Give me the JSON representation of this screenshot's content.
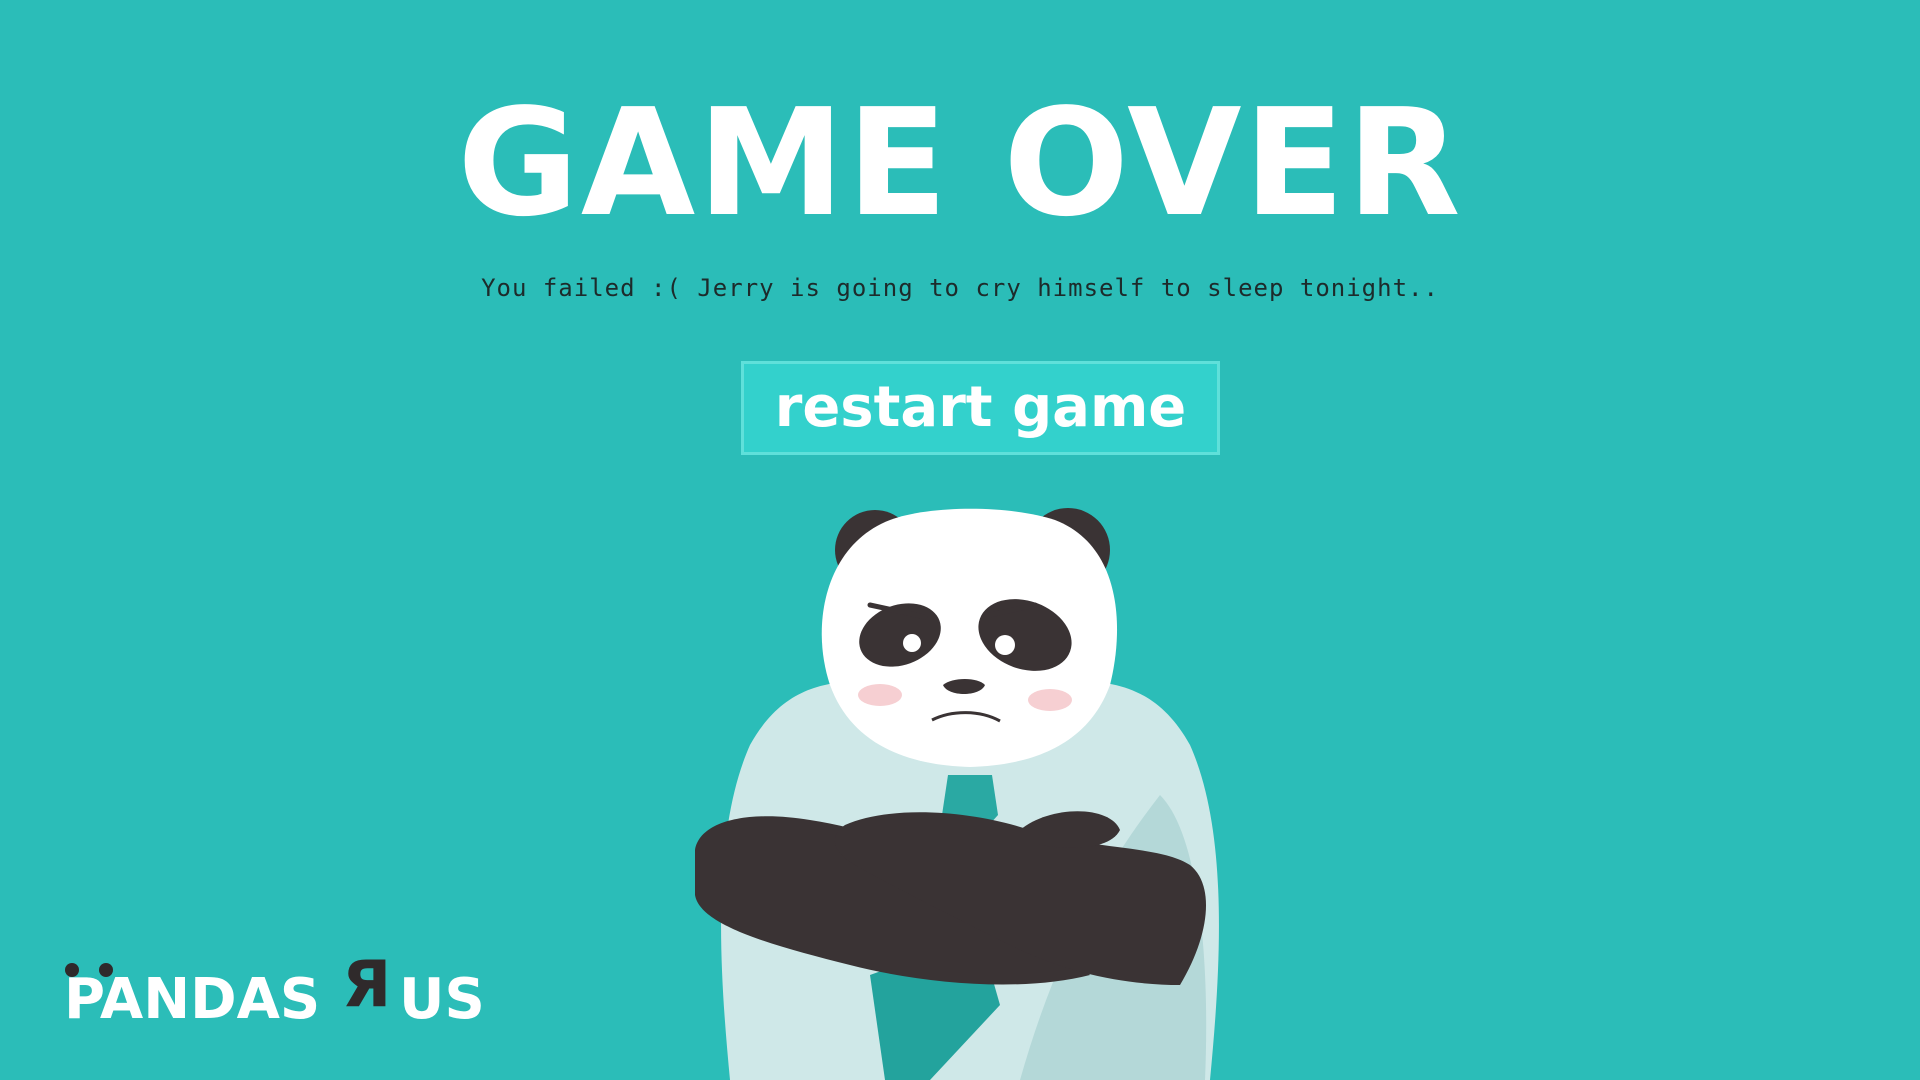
{
  "screen": {
    "title": "GAME OVER",
    "message": "You failed :( Jerry is going to cry himself to sleep tonight..",
    "restart_label": "restart game"
  },
  "character": {
    "name": "Jerry",
    "icon": "panda-character-icon"
  },
  "logo": {
    "text_left": "PANDAS",
    "text_r": "Я",
    "text_right": "US"
  },
  "colors": {
    "background": "#2bbdb8",
    "button": "#33d1cc",
    "text": "#ffffff",
    "panda_black": "#3a3334",
    "shirt": "#cfe8e8",
    "tie": "#2bbdb8"
  }
}
